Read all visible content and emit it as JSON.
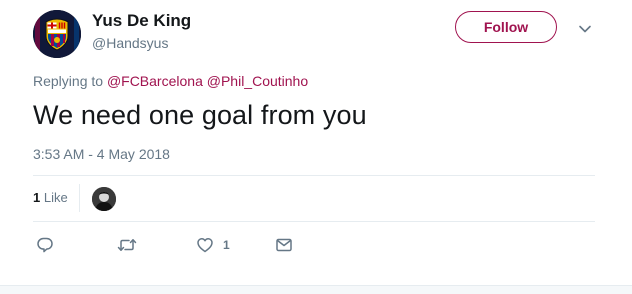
{
  "user": {
    "name": "Yus De King",
    "handle": "@Handsyus"
  },
  "follow_button": {
    "label": "Follow"
  },
  "reply_context": {
    "prefix": "Replying to",
    "mentions": [
      "@FCBarcelona",
      "@Phil_Coutinho"
    ]
  },
  "tweet": {
    "text": "We need one goal from you",
    "timestamp": "3:53 AM - 4 May 2018"
  },
  "stats": {
    "likes_count": "1",
    "likes_label": "Like"
  },
  "actions": {
    "reply_icon": "reply-icon",
    "retweet_icon": "retweet-icon",
    "like_icon": "heart-icon",
    "like_count": "1",
    "dm_icon": "envelope-icon"
  },
  "colors": {
    "accent": "#a0134f",
    "secondary_text": "#657786",
    "primary_text": "#14171a",
    "divider": "#e6ecf0"
  }
}
